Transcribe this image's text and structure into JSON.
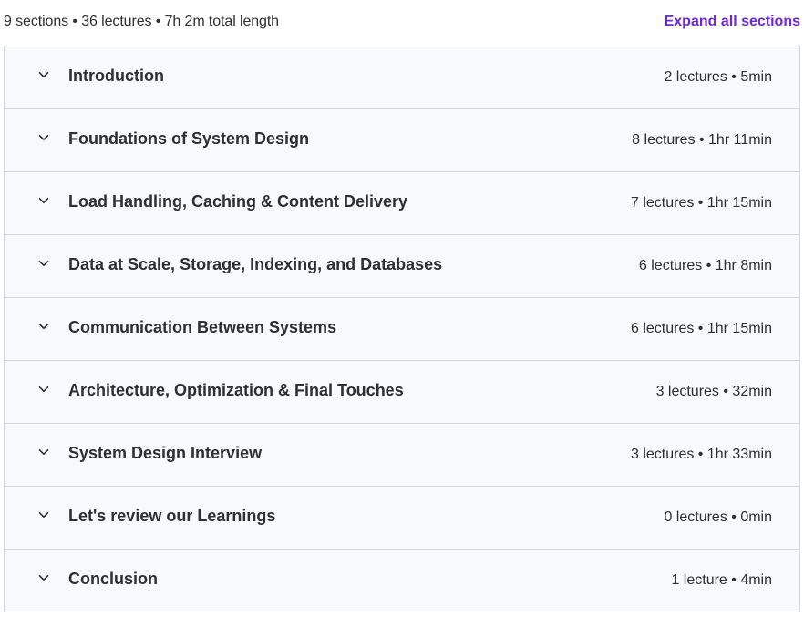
{
  "header": {
    "summary": "9 sections • 36 lectures • 7h 2m total length",
    "expand_label": "Expand all sections"
  },
  "colors": {
    "accent": "#6d28d2",
    "section_bg": "#f7f9fa",
    "border": "#d1d7dc",
    "text": "#2d2f31"
  },
  "sections": [
    {
      "title": "Introduction",
      "meta": "2 lectures • 5min",
      "icon": "chevron-down-icon"
    },
    {
      "title": "Foundations of System Design",
      "meta": "8 lectures • 1hr 11min",
      "icon": "chevron-down-icon"
    },
    {
      "title": "Load Handling, Caching & Content Delivery",
      "meta": "7 lectures • 1hr 15min",
      "icon": "chevron-down-icon"
    },
    {
      "title": "Data at Scale, Storage, Indexing, and Databases",
      "meta": "6 lectures • 1hr 8min",
      "icon": "chevron-down-icon"
    },
    {
      "title": "Communication Between Systems",
      "meta": "6 lectures • 1hr 15min",
      "icon": "chevron-down-icon"
    },
    {
      "title": "Architecture, Optimization & Final Touches",
      "meta": "3 lectures • 32min",
      "icon": "chevron-down-icon"
    },
    {
      "title": "System Design Interview",
      "meta": "3 lectures • 1hr 33min",
      "icon": "chevron-down-icon"
    },
    {
      "title": "Let's review our Learnings",
      "meta": "0 lectures • 0min",
      "icon": "chevron-down-icon"
    },
    {
      "title": "Conclusion",
      "meta": "1 lecture • 4min",
      "icon": "chevron-down-icon"
    }
  ]
}
